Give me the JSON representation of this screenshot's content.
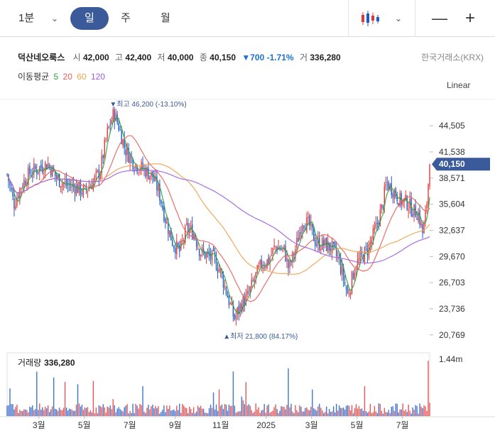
{
  "toolbar": {
    "period_label": "1분",
    "day_label": "일",
    "week_label": "주",
    "month_label": "월",
    "chevron_icon": "chevron-down-icon",
    "chart_type_icon": "candlestick-icon",
    "zoom_out_icon": "minus-icon",
    "zoom_in_icon": "plus-icon"
  },
  "stock": {
    "name": "덕산네오룩스",
    "open_label": "시",
    "open": "42,000",
    "high_label": "고",
    "high": "42,400",
    "low_label": "저",
    "low": "40,000",
    "close_label": "종",
    "close": "40,150",
    "change": "▼700 -1.71%",
    "volume_label": "거",
    "volume": "336,280",
    "exchange": "한국거래소(KRX)"
  },
  "ma": {
    "label": "이동평균",
    "p5": "5",
    "p20": "20",
    "p60": "60",
    "p120": "120"
  },
  "scale_mode": "Linear",
  "volume_panel": {
    "label": "거래량",
    "value": "336,280"
  },
  "colors": {
    "up": "#e2373a",
    "down": "#1e5bc6",
    "ma5": "#2e9e3e",
    "ma20": "#e8615a",
    "ma60": "#f0a14a",
    "ma120": "#9d5fe0",
    "current_tag": "#3a5a9a",
    "change_down": "#1e70d7"
  },
  "chart_data": {
    "type": "candlestick",
    "price_ticks": [
      "44,505",
      "41,538",
      "38,571",
      "35,604",
      "32,637",
      "29,670",
      "26,703",
      "23,736",
      "20,769"
    ],
    "price_tick_values": [
      44505,
      41538,
      38571,
      35604,
      32637,
      29670,
      26703,
      23736,
      20769
    ],
    "x_ticks": [
      "3월",
      "5월",
      "7월",
      "9월",
      "11월",
      "2025",
      "3월",
      "5월",
      "7월"
    ],
    "x_tick_months": [
      2,
      4,
      6,
      8,
      10,
      12,
      14,
      16,
      18
    ],
    "ylim": [
      19300,
      47500
    ],
    "xlim_months": [
      0.6,
      19.2
    ],
    "volume_tick": "1.44m",
    "volume_tick_value": 1440000,
    "current_price": {
      "value": 40150,
      "label": "40,150"
    },
    "high_annotation": {
      "value": 46200,
      "label": "▼최고 46,200 (-13.10%)",
      "month": 5.3
    },
    "low_annotation": {
      "value": 21800,
      "label": "▲최저 21,800 (84.17%)",
      "month": 10.3
    },
    "close_path": [
      [
        0.6,
        39000
      ],
      [
        0.9,
        35600
      ],
      [
        1.2,
        37600
      ],
      [
        1.6,
        39200
      ],
      [
        2.0,
        39700
      ],
      [
        2.4,
        40200
      ],
      [
        2.8,
        38500
      ],
      [
        3.2,
        37800
      ],
      [
        3.6,
        37600
      ],
      [
        4.0,
        37000
      ],
      [
        4.4,
        38200
      ],
      [
        4.7,
        39400
      ],
      [
        5.0,
        43600
      ],
      [
        5.3,
        46000
      ],
      [
        5.5,
        44600
      ],
      [
        5.8,
        41800
      ],
      [
        6.2,
        40200
      ],
      [
        6.6,
        39600
      ],
      [
        7.0,
        38800
      ],
      [
        7.3,
        36800
      ],
      [
        7.6,
        33600
      ],
      [
        7.9,
        31200
      ],
      [
        8.2,
        30200
      ],
      [
        8.5,
        32800
      ],
      [
        8.8,
        32400
      ],
      [
        9.1,
        30200
      ],
      [
        9.4,
        29800
      ],
      [
        9.7,
        29400
      ],
      [
        10.0,
        27900
      ],
      [
        10.3,
        25200
      ],
      [
        10.6,
        22600
      ],
      [
        10.9,
        24200
      ],
      [
        11.2,
        25200
      ],
      [
        11.5,
        27200
      ],
      [
        11.8,
        28800
      ],
      [
        12.1,
        29200
      ],
      [
        12.4,
        30800
      ],
      [
        12.8,
        30400
      ],
      [
        13.0,
        28200
      ],
      [
        13.3,
        30600
      ],
      [
        13.6,
        33800
      ],
      [
        13.9,
        33200
      ],
      [
        14.2,
        31200
      ],
      [
        14.6,
        31000
      ],
      [
        14.9,
        30600
      ],
      [
        15.2,
        29200
      ],
      [
        15.4,
        27200
      ],
      [
        15.6,
        25200
      ],
      [
        15.9,
        28400
      ],
      [
        16.2,
        29600
      ],
      [
        16.5,
        30600
      ],
      [
        16.8,
        32600
      ],
      [
        17.1,
        35200
      ],
      [
        17.3,
        38000
      ],
      [
        17.6,
        37200
      ],
      [
        17.9,
        36000
      ],
      [
        18.2,
        35800
      ],
      [
        18.5,
        34800
      ],
      [
        18.7,
        34600
      ],
      [
        18.9,
        32200
      ],
      [
        19.05,
        35000
      ],
      [
        19.2,
        40150
      ]
    ],
    "series": [
      {
        "name": "5",
        "key": "ma5"
      },
      {
        "name": "20",
        "key": "ma20"
      },
      {
        "name": "60",
        "key": "ma60"
      },
      {
        "name": "120",
        "key": "ma120"
      }
    ]
  }
}
